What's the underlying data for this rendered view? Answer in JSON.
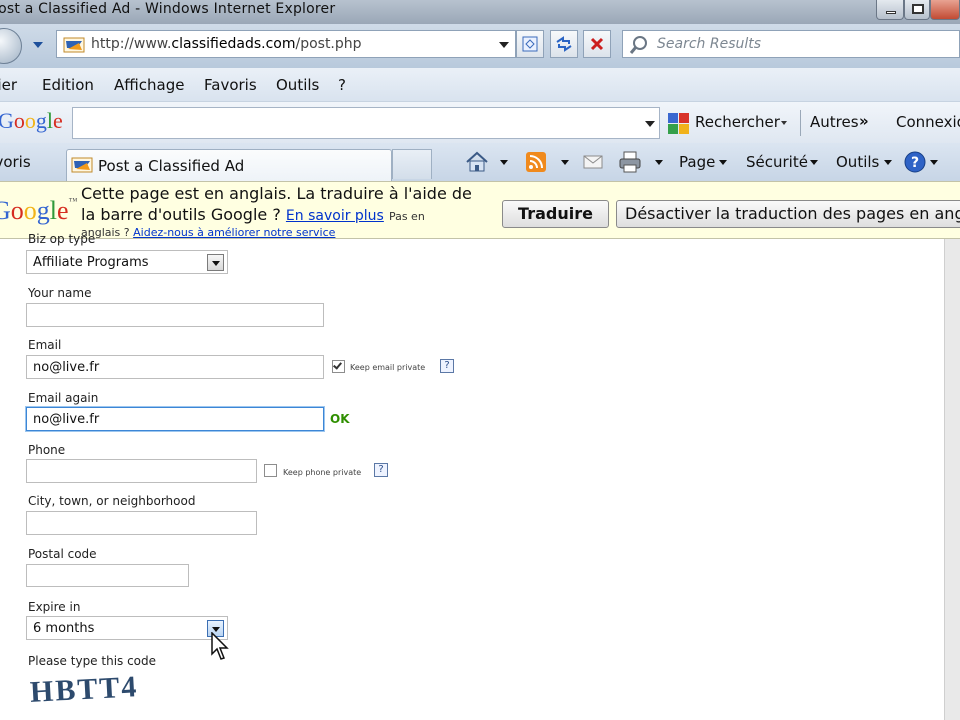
{
  "window": {
    "title": "Post a Classified Ad - Windows Internet Explorer"
  },
  "address_bar": {
    "url_prefix": "http://www.",
    "url_domain": "classifiedads.com",
    "url_path": "/post.php",
    "search_placeholder": "Search Results"
  },
  "menu": {
    "items": [
      "Fichier",
      "Edition",
      "Affichage",
      "Favoris",
      "Outils",
      "?"
    ]
  },
  "google_toolbar": {
    "logo_text": "Google",
    "search_button": "Rechercher",
    "more_label": "Autres",
    "connect_label": "Connexion"
  },
  "tabs": {
    "favorites_label": "Favoris",
    "active_tab": "Post a Classified Ad",
    "page_menu": "Page",
    "security_menu": "Sécurité",
    "tools_menu": "Outils"
  },
  "translation_bar": {
    "message_line1": "Cette page est en anglais. La traduire à l'aide de",
    "message_line2": "la barre d'outils Google ?",
    "learn_more_link": "En savoir plus",
    "not_english_line1": "Pas en",
    "not_english_line2": "anglais ?",
    "help_link": "Aidez-nous à améliorer notre service",
    "translate_button": "Traduire",
    "disable_button": "Désactiver la traduction des pages en anglais"
  },
  "form": {
    "biz_type_label": "Biz op type",
    "biz_type_value": "Affiliate Programs",
    "your_name_label": "Your name",
    "your_name_value": "",
    "email_label": "Email",
    "email_value": "no@live.fr",
    "keep_email_private": "Keep email private",
    "keep_email_checked": true,
    "email_again_label": "Email again",
    "email_again_value": "no@live.fr",
    "email_ok": "OK",
    "phone_label": "Phone",
    "phone_value": "",
    "keep_phone_private": "Keep phone private",
    "keep_phone_checked": false,
    "city_label": "City, town, or neighborhood",
    "city_value": "",
    "postal_label": "Postal code",
    "postal_value": "",
    "expire_label": "Expire in",
    "expire_value": "6 months",
    "captcha_label": "Please type this code",
    "captcha_text": "HBTT4",
    "help_glyph": "?"
  },
  "colors": {
    "ok_green": "#2f8f00",
    "link_blue": "#0033cc",
    "captcha_blue": "#2d4a6d"
  }
}
